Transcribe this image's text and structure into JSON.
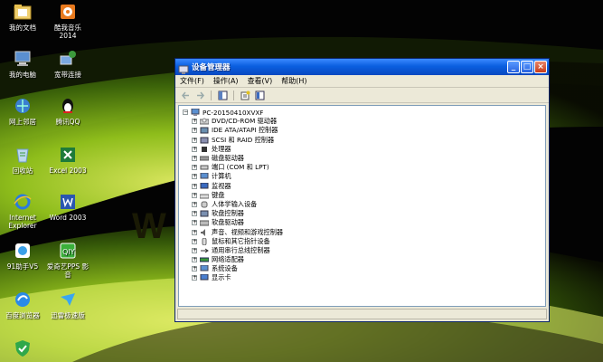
{
  "desktop": {
    "wallpaper_text": "W",
    "icons": [
      {
        "name": "my-documents",
        "label": "我的文档"
      },
      {
        "name": "kugou-music",
        "label": "酷我音乐\n2014"
      },
      {
        "name": "my-computer",
        "label": "我的电脑"
      },
      {
        "name": "broadband",
        "label": "宽带连接"
      },
      {
        "name": "network-neighborhood",
        "label": "网上邻居"
      },
      {
        "name": "tencent-qq",
        "label": "腾讯QQ"
      },
      {
        "name": "recycle-bin",
        "label": "回收站"
      },
      {
        "name": "excel-2003",
        "label": "Excel 2003"
      },
      {
        "name": "internet-explorer",
        "label": "Internet\nExplorer"
      },
      {
        "name": "word-2003",
        "label": "Word 2003"
      },
      {
        "name": "91-assistant",
        "label": "91助手V5"
      },
      {
        "name": "iqiyi-video",
        "label": "爱奇艺PPS 影\n音"
      },
      {
        "name": "baidu-browser",
        "label": "百度浏览器"
      },
      {
        "name": "xunlei-speed",
        "label": "迅雷极速版"
      },
      {
        "name": "security-guard",
        "label": ""
      }
    ]
  },
  "window": {
    "title": "设备管理器",
    "buttons": {
      "minimize": "_",
      "maximize": "□",
      "close": "×"
    },
    "menu": [
      "文件(F)",
      "操作(A)",
      "查看(V)",
      "帮助(H)"
    ],
    "tree": {
      "root": "PC-20150410XVXF",
      "items": [
        "DVD/CD-ROM 驱动器",
        "IDE ATA/ATAPI 控制器",
        "SCSI 和 RAID 控制器",
        "处理器",
        "磁盘驱动器",
        "端口 (COM 和 LPT)",
        "计算机",
        "监视器",
        "键盘",
        "人体学输入设备",
        "软盘控制器",
        "软盘驱动器",
        "声音、视频和游戏控制器",
        "鼠标和其它指针设备",
        "通用串行总线控制器",
        "网络适配器",
        "系统设备",
        "显示卡"
      ]
    }
  }
}
